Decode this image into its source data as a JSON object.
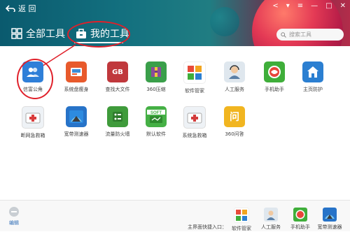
{
  "header": {
    "back_label": "返 回",
    "tab_all": "全部工具",
    "tab_mine": "我的工具",
    "search_placeholder": "搜索工具"
  },
  "tools": [
    {
      "label": "信富公角",
      "icon": "user-group-icon",
      "color": "#2f7fd8"
    },
    {
      "label": "系统盘瘦身",
      "icon": "disk-slim-icon",
      "color": "#e85a2c"
    },
    {
      "label": "查找大文件",
      "icon": "gb-file-icon",
      "color": "#c0383c"
    },
    {
      "label": "360压缩",
      "icon": "archive-icon",
      "color": "#3a9f4a"
    },
    {
      "label": "软件管家",
      "icon": "software-manager-icon",
      "color": "#f2a51f"
    },
    {
      "label": "人工服务",
      "icon": "customer-service-icon",
      "color": "#6a8fb0"
    },
    {
      "label": "手机助手",
      "icon": "phone-assistant-icon",
      "color": "#3fae3a"
    },
    {
      "label": "主页防护",
      "icon": "home-shield-icon",
      "color": "#2b7fd1"
    },
    {
      "label": "断网急救箱",
      "icon": "network-first-aid-icon",
      "color": "#d93d3d"
    },
    {
      "label": "宽带测速器",
      "icon": "speed-test-icon",
      "color": "#2773c8"
    },
    {
      "label": "流量防火墙",
      "icon": "traffic-firewall-icon",
      "color": "#3f9b3b"
    },
    {
      "label": "默认软件",
      "icon": "soft-icon",
      "color": "#45b045"
    },
    {
      "label": "系统急救箱",
      "icon": "system-first-aid-icon",
      "color": "#d23c3c"
    },
    {
      "label": "360问答",
      "icon": "qa-icon",
      "color": "#f1b520"
    }
  ],
  "footer": {
    "edit_label": "编辑",
    "quick_entry_label": "主界面快捷入口：",
    "quick_items": [
      {
        "label": "软件管家",
        "icon": "software-manager-icon",
        "color": "#f2a51f"
      },
      {
        "label": "人工服务",
        "icon": "customer-service-icon",
        "color": "#6a8fb0"
      },
      {
        "label": "手机助手",
        "icon": "phone-assistant-icon",
        "color": "#3fae3a"
      },
      {
        "label": "宽带测速器",
        "icon": "speed-test-icon",
        "color": "#2773c8"
      }
    ]
  },
  "annotation_color": "#e0202a"
}
